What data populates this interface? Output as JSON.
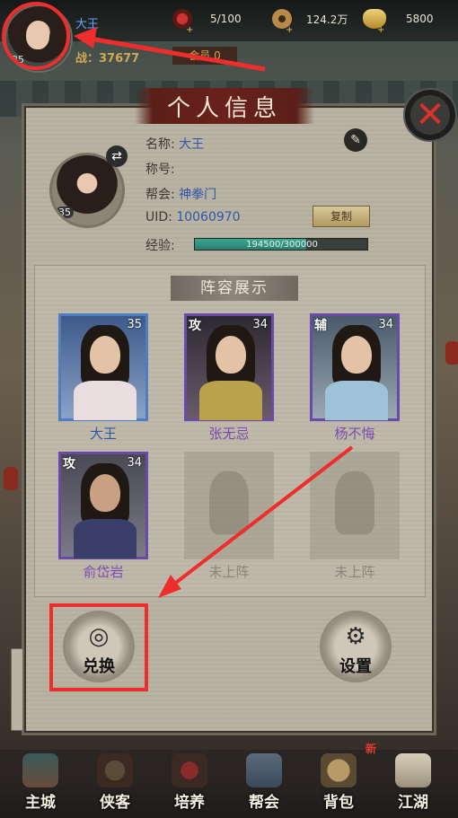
{
  "topbar": {
    "player_name": "大王",
    "level": "35",
    "power_label": "战：37677",
    "member_label": "会员 0",
    "resources": [
      {
        "icon": "stamina-icon",
        "value": "5/100"
      },
      {
        "icon": "copper-coin-icon",
        "value": "124.2万"
      },
      {
        "icon": "gold-ingot-icon",
        "value": "5800"
      }
    ]
  },
  "panel": {
    "title": "个人信息",
    "close_label": "✕",
    "profile": {
      "level": "35",
      "name_label": "名称:",
      "name_value": "大王",
      "title_label": "称号:",
      "title_value": "",
      "guild_label": "帮会:",
      "guild_value": "神拳门",
      "uid_label": "UID:",
      "uid_value": "10060970",
      "copy_label": "复制",
      "exp_label": "经验:",
      "exp_text": "194500/300000",
      "exp_fraction": 0.648
    },
    "lineup": {
      "title": "阵容展示",
      "slots": [
        {
          "name": "大王",
          "level": "35",
          "tag": "",
          "color": "#2f57a7",
          "border": "blue"
        },
        {
          "name": "张无忌",
          "level": "34",
          "tag": "攻",
          "color": "#7a4ab0",
          "border": "purple"
        },
        {
          "name": "杨不悔",
          "level": "34",
          "tag": "辅",
          "color": "#7a4ab0",
          "border": "purple"
        },
        {
          "name": "俞岱岩",
          "level": "34",
          "tag": "攻",
          "color": "#7a4ab0",
          "border": "purple"
        },
        {
          "name": "未上阵",
          "level": "",
          "tag": "",
          "color": "#8a857a",
          "border": "empty"
        },
        {
          "name": "未上阵",
          "level": "",
          "tag": "",
          "color": "#8a857a",
          "border": "empty"
        }
      ]
    },
    "redeem_label": "兑换",
    "settings_label": "设置"
  },
  "bottom_nav": {
    "new_badge": "新",
    "items": [
      {
        "label": "主城",
        "icon": "main-city-icon"
      },
      {
        "label": "侠客",
        "icon": "heroes-icon"
      },
      {
        "label": "培养",
        "icon": "cultivate-icon"
      },
      {
        "label": "帮会",
        "icon": "guild-icon"
      },
      {
        "label": "背包",
        "icon": "backpack-icon"
      },
      {
        "label": "江湖",
        "icon": "jianghu-icon"
      }
    ]
  },
  "colors": {
    "accent_red": "#ee2d2d",
    "name_blue": "#2f57a7",
    "purple_name": "#7a4ab0",
    "exp_green": "#2a7e6b"
  }
}
